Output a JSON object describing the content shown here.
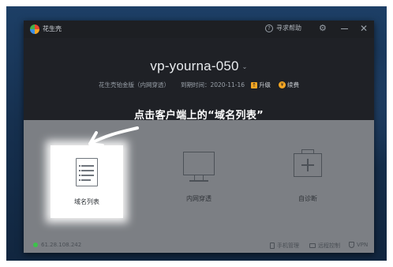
{
  "window": {
    "app_title": "花生壳",
    "help_label": "寻求帮助",
    "help_icon": "?",
    "gear_glyph": "⚙",
    "close_glyph": "✕"
  },
  "account": {
    "title_prefix": "vp-you",
    "title_hidden": "",
    "title_suffix": "rna-050",
    "dropdown_glyph": "⌄",
    "edition": "花生壳铂金版（内网穿透）",
    "expiry": "到期时间：2020-11-16",
    "upgrade_label": "升级",
    "upgrade_glyph": "↑",
    "renew_label": "续费",
    "renew_glyph": "¥"
  },
  "overlay": {
    "instruction": "点击客户端上的“域名列表”"
  },
  "features": [
    {
      "label": "域名列表",
      "icon": "document-list-icon"
    },
    {
      "label": "内网穿透",
      "icon": "monitor-icon"
    },
    {
      "label": "自诊断",
      "icon": "medical-kit-icon"
    }
  ],
  "status": {
    "ip": "61.28.108.242",
    "ip_color": "#3cc24a",
    "mobile_label": "手机管理",
    "remote_label": "远程控制",
    "vpn_label": "VPN"
  }
}
